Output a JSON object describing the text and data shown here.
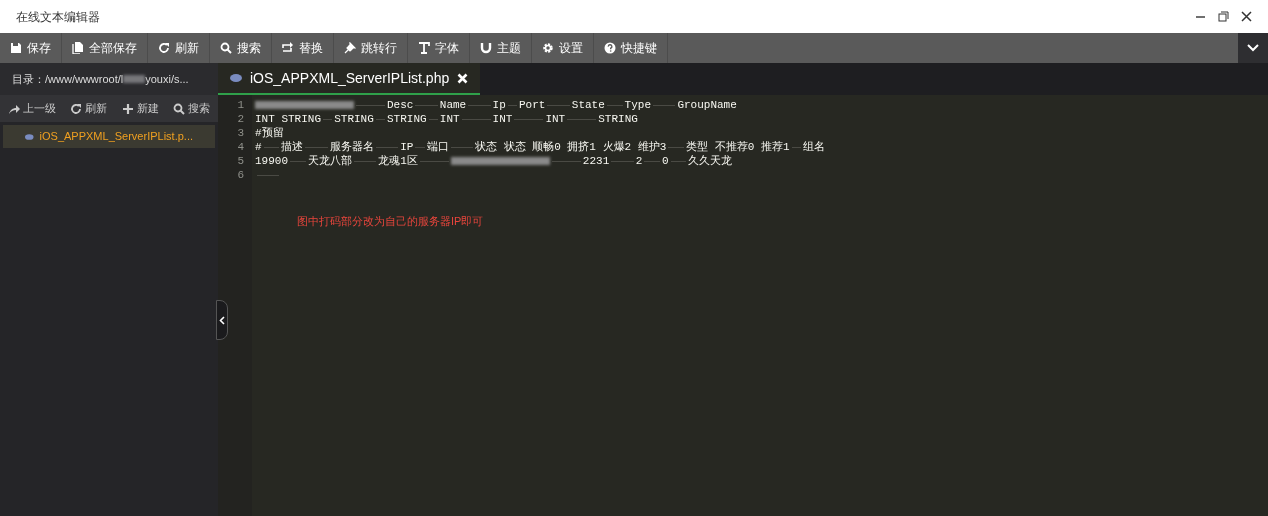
{
  "window": {
    "title": "在线文本编辑器"
  },
  "toolbar": [
    {
      "label": "保存"
    },
    {
      "label": "全部保存"
    },
    {
      "label": "刷新"
    },
    {
      "label": "搜索"
    },
    {
      "label": "替换"
    },
    {
      "label": "跳转行"
    },
    {
      "label": "字体"
    },
    {
      "label": "主题"
    },
    {
      "label": "设置"
    },
    {
      "label": "快捷键"
    }
  ],
  "sidebar": {
    "path_start": "目录：/www/wwwroot/l",
    "path_end": "youxi/s...",
    "actions": [
      {
        "label": "上一级"
      },
      {
        "label": "刷新"
      },
      {
        "label": "新建"
      },
      {
        "label": "搜索"
      }
    ],
    "files": [
      {
        "name": "iOS_APPXML_ServerIPList.p...",
        "selected": true
      }
    ]
  },
  "tabs": [
    {
      "label": "iOS_APPXML_ServerIPList.php",
      "selected": true
    }
  ],
  "editor": {
    "lines": [
      {
        "number": "1",
        "tokens": [
          {
            "kind": "redacted"
          },
          {
            "kind": "text",
            "text": "Desc"
          },
          {
            "kind": "text",
            "text": "Name"
          },
          {
            "kind": "text",
            "text": "Ip"
          },
          {
            "kind": "text",
            "text": "Port"
          },
          {
            "kind": "text",
            "text": "State"
          },
          {
            "kind": "text",
            "text": "Type"
          },
          {
            "kind": "text",
            "text": "GroupName"
          }
        ]
      },
      {
        "number": "2",
        "tokens": [
          {
            "kind": "text",
            "text": "INT STRING"
          },
          {
            "kind": "text",
            "text": "STRING"
          },
          {
            "kind": "text",
            "text": "STRING"
          },
          {
            "kind": "text",
            "text": "INT"
          },
          {
            "kind": "text",
            "text": "INT"
          },
          {
            "kind": "text",
            "text": "INT"
          },
          {
            "kind": "text",
            "text": "STRING"
          }
        ]
      },
      {
        "number": "3",
        "tokens": [
          {
            "kind": "text",
            "text": "#预留"
          }
        ]
      },
      {
        "number": "4",
        "tokens": [
          {
            "kind": "text",
            "text": "#"
          },
          {
            "kind": "text",
            "text": "描述"
          },
          {
            "kind": "text",
            "text": "服务器名"
          },
          {
            "kind": "text",
            "text": "IP"
          },
          {
            "kind": "text",
            "text": "端口"
          },
          {
            "kind": "text",
            "text": "状态 状态 顺畅0 拥挤1 火爆2 维护3"
          },
          {
            "kind": "text",
            "text": "类型 不推荐0 推荐1"
          },
          {
            "kind": "text",
            "text": "组名"
          }
        ]
      },
      {
        "number": "5",
        "tokens": [
          {
            "kind": "text",
            "text": "19900"
          },
          {
            "kind": "text",
            "text": "天龙八部"
          },
          {
            "kind": "text",
            "text": "龙魂1区"
          },
          {
            "kind": "redacted"
          },
          {
            "kind": "text",
            "text": "2231"
          },
          {
            "kind": "text",
            "text": "2"
          },
          {
            "kind": "text",
            "text": "0"
          },
          {
            "kind": "text",
            "text": "久久天龙"
          }
        ]
      },
      {
        "number": "6"
      }
    ],
    "note": "图中打码部分改为自己的服务器IP即可"
  }
}
